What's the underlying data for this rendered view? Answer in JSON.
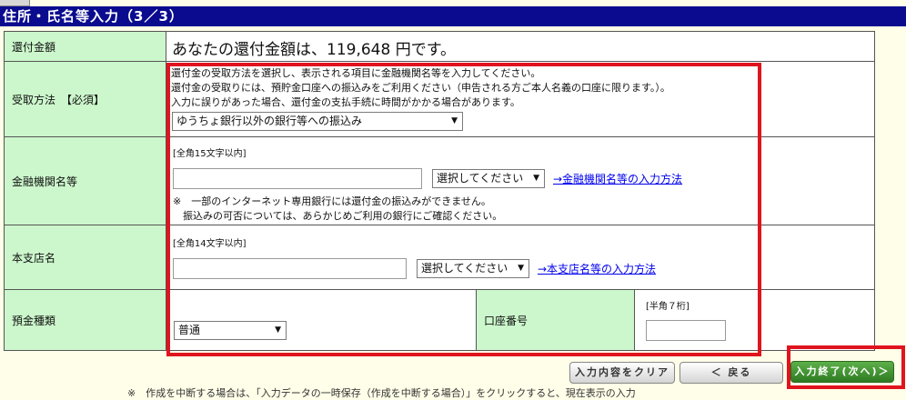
{
  "header": {
    "title": "住所・氏名等入力（3／3）"
  },
  "refund_amount": {
    "label": "還付金額",
    "text": "あなたの還付金額は、119,648 円です。"
  },
  "receipt_method": {
    "label": "受取方法　【必須】",
    "lines": [
      "還付金の受取方法を選択し、表示される項目に金融機関名等を入力してください。",
      "還付金の受取りには、預貯金口座への振込みをご利用ください（申告される方ご本人名義の口座に限ります。）。",
      "入力に誤りがあった場合、還付金の支払手続に時間がかかる場合があります。"
    ],
    "selected": "ゆうちょ銀行以外の銀行等への振込み"
  },
  "bank": {
    "label": "金融機関名等",
    "hint": "[全角15文字以内]",
    "value": "",
    "select_value": "選択してください",
    "link": "→金融機関名等の入力方法",
    "note1": "※　一部のインターネット専用銀行には還付金の振込みができません。",
    "note2": "振込みの可否については、あらかじめご利用の銀行にご確認ください。"
  },
  "branch": {
    "label": "本支店名",
    "hint": "[全角14文字以内]",
    "value": "",
    "select_value": "選択してください",
    "link": "→本支店名等の入力方法"
  },
  "deposit_type": {
    "label": "預金種類",
    "selected": "普通"
  },
  "account_number": {
    "label": "口座番号",
    "hint": "[半角７桁]",
    "value": ""
  },
  "buttons": {
    "clear": "入力内容をクリア",
    "back": "＜ 戻る",
    "next": "入力終了(次へ)＞"
  },
  "footnote": "※　作成を中断する場合は、「入力データの一時保存（作成を中断する場合）」をクリックすると、現在表示の入力"
}
